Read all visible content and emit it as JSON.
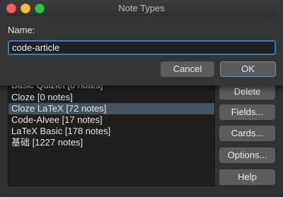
{
  "window": {
    "title": "Note Types"
  },
  "dialog": {
    "name_label": "Name:",
    "name_value": "code-article",
    "cancel_label": "Cancel",
    "ok_label": "OK"
  },
  "list": {
    "items": [
      "Basic Quizlet [0 notes]",
      "Cloze [0 notes]",
      "Cloze LaTeX [72 notes]",
      "Code-Alvee [17 notes]",
      "LaTeX Basic [178 notes]",
      "基础 [1227 notes]"
    ],
    "selected_index": 2
  },
  "side_buttons": {
    "delete": "Delete",
    "fields": "Fields...",
    "cards": "Cards...",
    "options": "Options...",
    "help": "Help"
  },
  "colors": {
    "selection": "#465461",
    "focus_ring": "#3f7ab9"
  }
}
